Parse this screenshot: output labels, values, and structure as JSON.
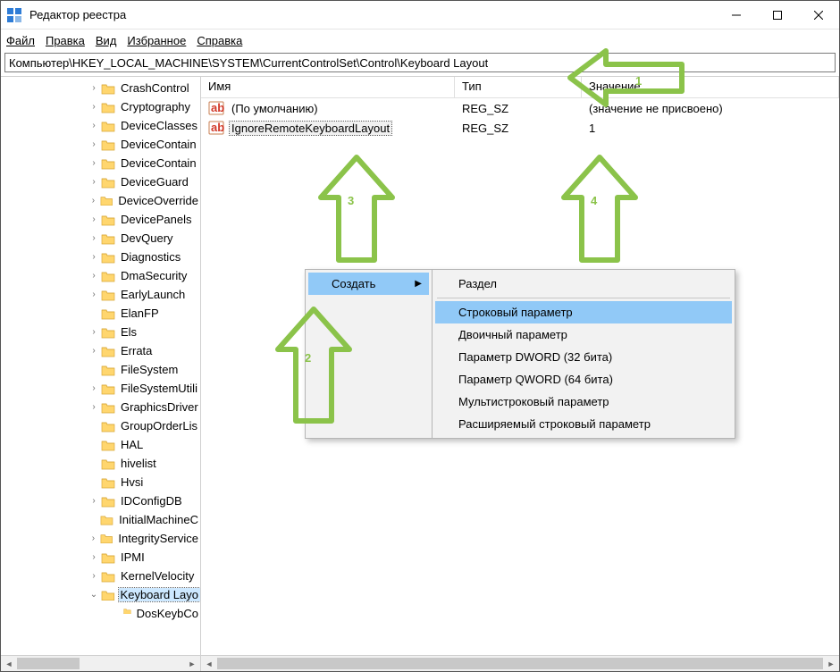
{
  "window": {
    "title": "Редактор реестра"
  },
  "menu": {
    "file": "Файл",
    "edit": "Правка",
    "view": "Вид",
    "favorites": "Избранное",
    "help": "Справка"
  },
  "addressbar": {
    "path": "Компьютер\\HKEY_LOCAL_MACHINE\\SYSTEM\\CurrentControlSet\\Control\\Keyboard Layout"
  },
  "columns": {
    "name": "Имя",
    "type": "Тип",
    "value": "Значение"
  },
  "tree": {
    "items": [
      {
        "label": "CrashControl",
        "expandable": true
      },
      {
        "label": "Cryptography",
        "expandable": true
      },
      {
        "label": "DeviceClasses",
        "expandable": true
      },
      {
        "label": "DeviceContain",
        "expandable": true
      },
      {
        "label": "DeviceContain",
        "expandable": true
      },
      {
        "label": "DeviceGuard",
        "expandable": true
      },
      {
        "label": "DeviceOverride",
        "expandable": true
      },
      {
        "label": "DevicePanels",
        "expandable": true
      },
      {
        "label": "DevQuery",
        "expandable": true
      },
      {
        "label": "Diagnostics",
        "expandable": true
      },
      {
        "label": "DmaSecurity",
        "expandable": true
      },
      {
        "label": "EarlyLaunch",
        "expandable": true
      },
      {
        "label": "ElanFP",
        "expandable": false
      },
      {
        "label": "Els",
        "expandable": true
      },
      {
        "label": "Errata",
        "expandable": true
      },
      {
        "label": "FileSystem",
        "expandable": false
      },
      {
        "label": "FileSystemUtili",
        "expandable": true
      },
      {
        "label": "GraphicsDriver",
        "expandable": true
      },
      {
        "label": "GroupOrderLis",
        "expandable": false
      },
      {
        "label": "HAL",
        "expandable": false
      },
      {
        "label": "hivelist",
        "expandable": false
      },
      {
        "label": "Hvsi",
        "expandable": false
      },
      {
        "label": "IDConfigDB",
        "expandable": true
      },
      {
        "label": "InitialMachineC",
        "expandable": false
      },
      {
        "label": "IntegrityService",
        "expandable": true
      },
      {
        "label": "IPMI",
        "expandable": true
      },
      {
        "label": "KernelVelocity",
        "expandable": true
      },
      {
        "label": "Keyboard Layo",
        "expandable": true,
        "expanded": true,
        "selected": true
      }
    ],
    "child": {
      "label": "DosKeybCo"
    }
  },
  "values": [
    {
      "name": "(По умолчанию)",
      "type": "REG_SZ",
      "data": "(значение не присвоено)",
      "selected": false
    },
    {
      "name": "IgnoreRemoteKeyboardLayout",
      "type": "REG_SZ",
      "data": "1",
      "selected": true
    }
  ],
  "context_menu": {
    "create": "Создать",
    "items": [
      "Раздел",
      "Строковый параметр",
      "Двоичный параметр",
      "Параметр DWORD (32 бита)",
      "Параметр QWORD (64 бита)",
      "Мультистроковый параметр",
      "Расширяемый строковый параметр"
    ],
    "selected_index": 1
  },
  "annotations": {
    "a1": "1",
    "a2": "2",
    "a3": "3",
    "a4": "4"
  }
}
